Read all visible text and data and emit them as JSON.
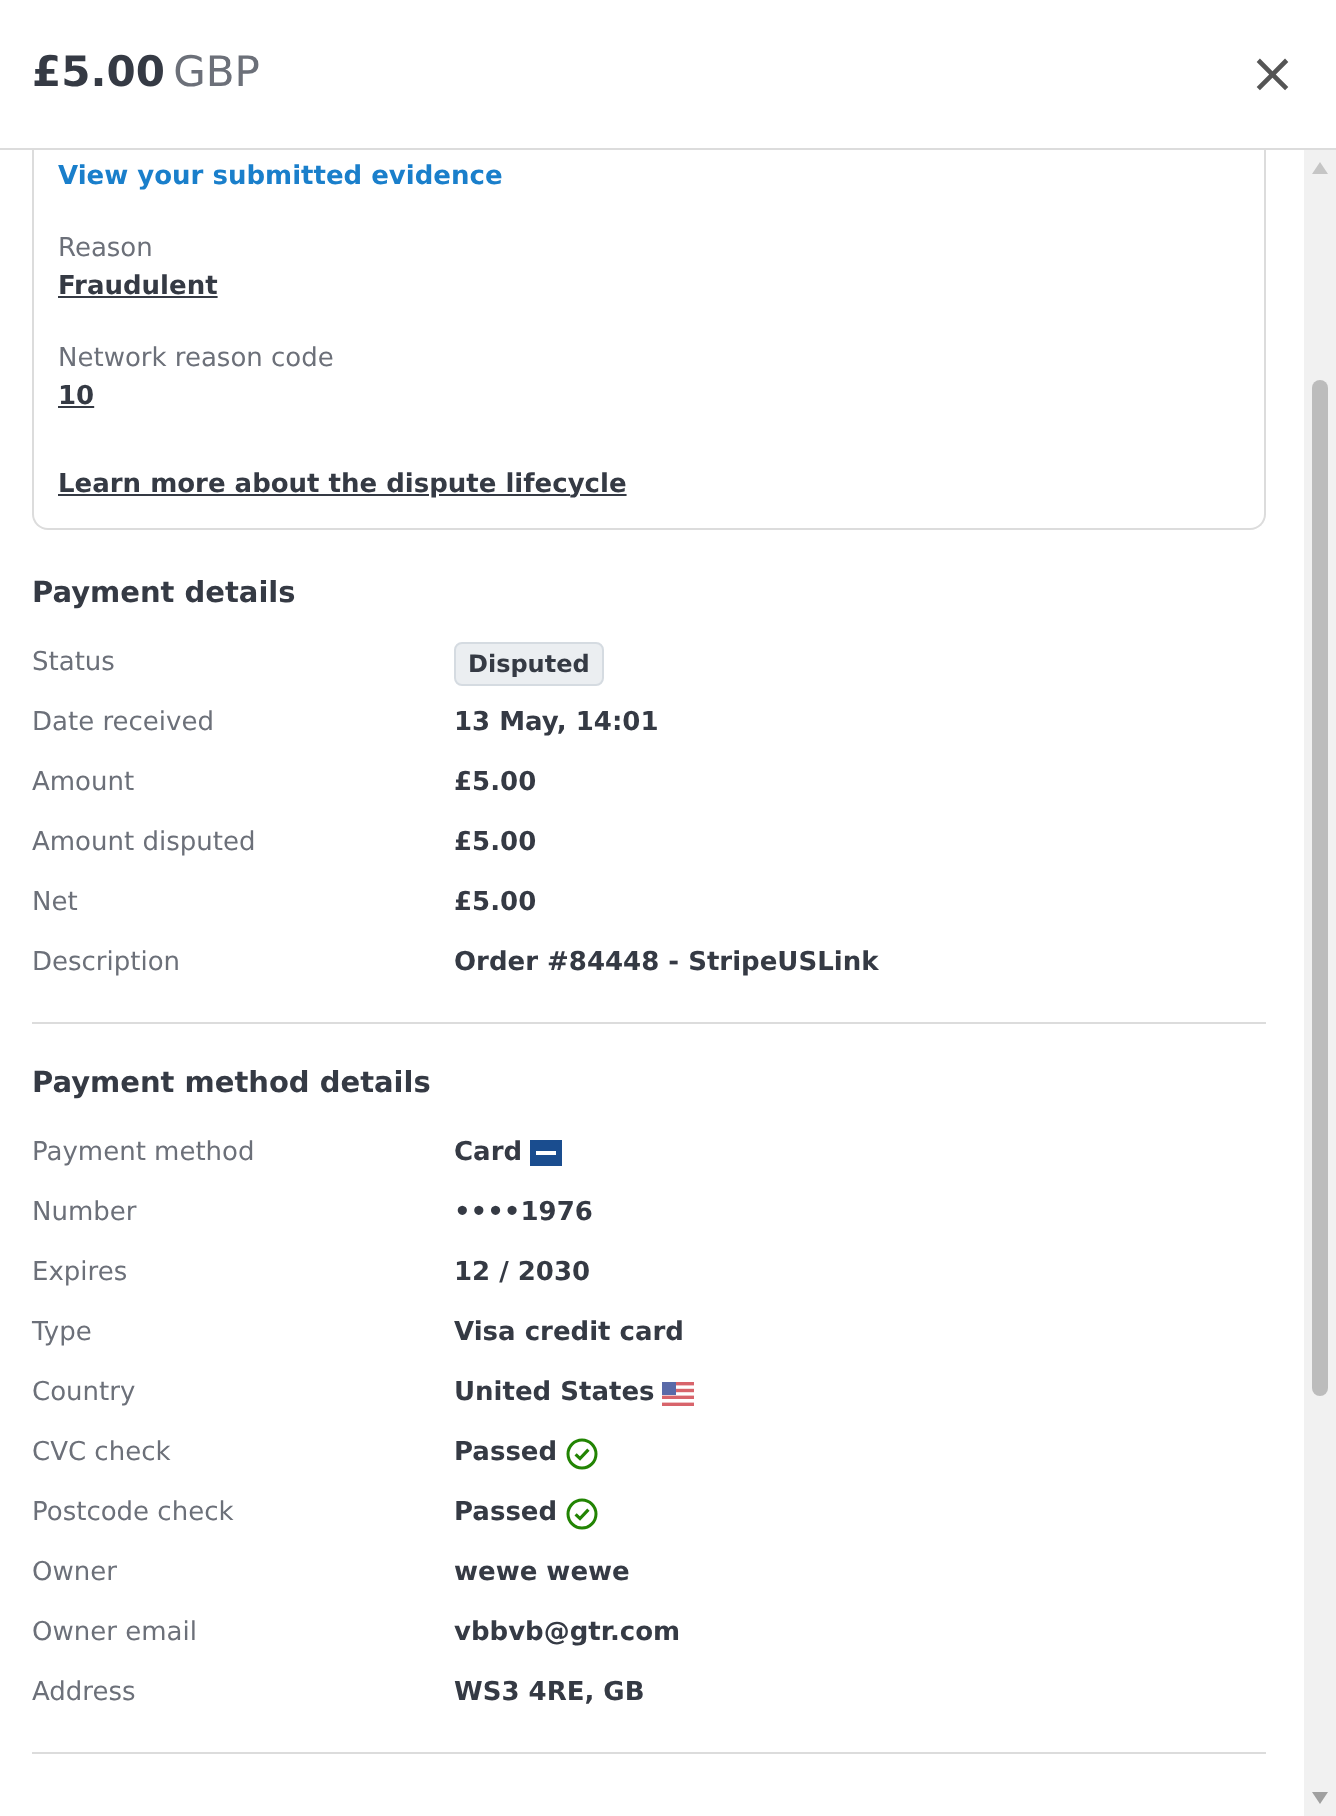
{
  "header": {
    "amount": "£5.00",
    "currency": "GBP",
    "close": "×"
  },
  "dispute_card": {
    "evidence_link": "View your submitted evidence",
    "fields": [
      {
        "label": "Reason",
        "value": "Fraudulent"
      },
      {
        "label": "Network reason code",
        "value": "10"
      }
    ],
    "lifecycle_link": "Learn more about the dispute lifecycle"
  },
  "sections": [
    {
      "title": "Payment details",
      "rows": [
        {
          "label": "Status",
          "value": "Disputed",
          "kind": "badge"
        },
        {
          "label": "Date received",
          "value": "13 May, 14:01",
          "kind": "text"
        },
        {
          "label": "Amount",
          "value": "£5.00",
          "kind": "text"
        },
        {
          "label": "Amount disputed",
          "value": "£5.00",
          "kind": "text"
        },
        {
          "label": "Net",
          "value": "£5.00",
          "kind": "text"
        },
        {
          "label": "Description",
          "value": "Order #84448 - StripeUSLink",
          "kind": "text"
        }
      ]
    },
    {
      "title": "Payment method details",
      "rows": [
        {
          "label": "Payment method",
          "value": "Card",
          "kind": "card"
        },
        {
          "label": "Number",
          "value": "••••1976",
          "kind": "text"
        },
        {
          "label": "Expires",
          "value": "12 / 2030",
          "kind": "text"
        },
        {
          "label": "Type",
          "value": "Visa credit card",
          "kind": "text"
        },
        {
          "label": "Country",
          "value": "United States",
          "kind": "flag"
        },
        {
          "label": "CVC check",
          "value": "Passed",
          "kind": "check"
        },
        {
          "label": "Postcode check",
          "value": "Passed",
          "kind": "check"
        },
        {
          "label": "Owner",
          "value": "wewe wewe",
          "kind": "text"
        },
        {
          "label": "Owner email",
          "value": "vbbvb@gtr.com",
          "kind": "text"
        },
        {
          "label": "Address",
          "value": "WS3 4RE, GB",
          "kind": "text"
        }
      ]
    }
  ]
}
